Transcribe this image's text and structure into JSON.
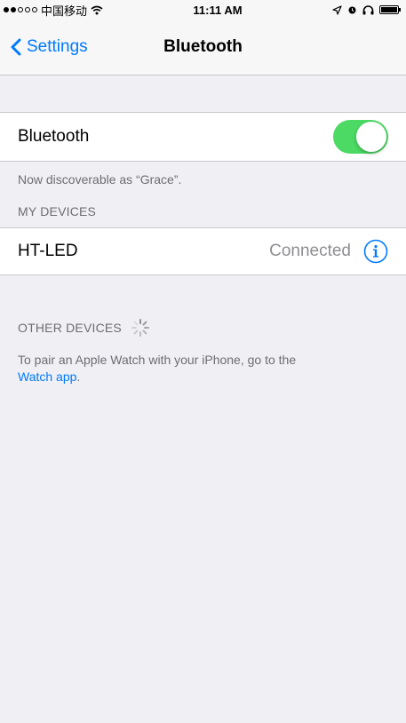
{
  "status_bar": {
    "carrier": "中国移动",
    "time": "11:11 AM"
  },
  "nav": {
    "back_label": "Settings",
    "title": "Bluetooth"
  },
  "bluetooth": {
    "label": "Bluetooth",
    "enabled": true,
    "toggle_color": "#4cd964",
    "discoverable_text": "Now discoverable as “Grace”."
  },
  "my_devices": {
    "header": "MY DEVICES",
    "items": [
      {
        "name": "HT-LED",
        "status": "Connected",
        "icon": "info-icon"
      }
    ]
  },
  "other_devices": {
    "header": "OTHER DEVICES",
    "note_prefix": "To pair an Apple Watch with your iPhone, go to the",
    "note_link": "Watch app",
    "note_suffix": "."
  },
  "colors": {
    "accent": "#007aff",
    "background": "#efeff4"
  }
}
